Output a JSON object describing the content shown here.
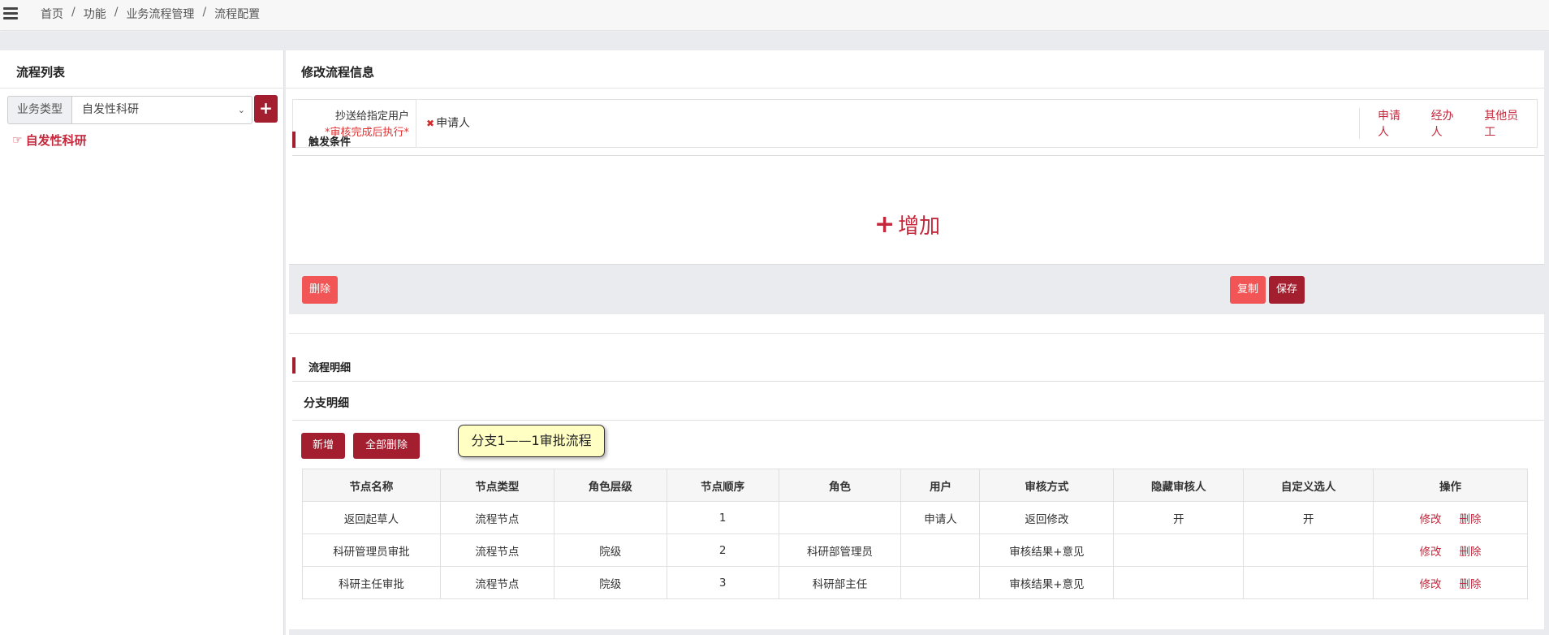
{
  "breadcrumb": [
    "首页",
    "功能",
    "业务流程管理",
    "流程配置"
  ],
  "left": {
    "title": "流程列表",
    "type_label": "业务类型",
    "type_value": "自发性科研",
    "add_symbol": "+",
    "tree_item": "自发性科研"
  },
  "right": {
    "title": "修改流程信息",
    "cc": {
      "label": "抄送给指定用户",
      "note": "*审核完成后执行*",
      "tag": "申请人",
      "options": [
        "申请人",
        "经办人",
        "其他员工"
      ]
    },
    "trigger": {
      "title": "触发条件",
      "add_label": "增加"
    },
    "actions": {
      "delete": "删除",
      "copy": "复制",
      "save": "保存"
    },
    "detail_title": "流程明细",
    "branch_title": "分支明细",
    "buttons": {
      "add": "新增",
      "delete_all": "全部删除"
    },
    "tooltip": "分支1——1审批流程",
    "table": {
      "headers": [
        "节点名称",
        "节点类型",
        "角色层级",
        "节点顺序",
        "角色",
        "用户",
        "审核方式",
        "隐藏审核人",
        "自定义选人",
        "操作"
      ],
      "rows": [
        [
          "返回起草人",
          "流程节点",
          "",
          "1",
          "",
          "申请人",
          "返回修改",
          "开",
          "开"
        ],
        [
          "科研管理员审批",
          "流程节点",
          "院级",
          "2",
          "科研部管理员",
          "",
          "审核结果+意见",
          "",
          ""
        ],
        [
          "科研主任审批",
          "流程节点",
          "院级",
          "3",
          "科研部主任",
          "",
          "审核结果+意见",
          "",
          ""
        ]
      ],
      "row_actions": [
        "修改",
        "删除"
      ]
    }
  },
  "colors": {
    "brand": "#a31e2f",
    "coral": "#f25555",
    "link": "#c4283c",
    "tooltip_bg": "#ffffc4"
  }
}
